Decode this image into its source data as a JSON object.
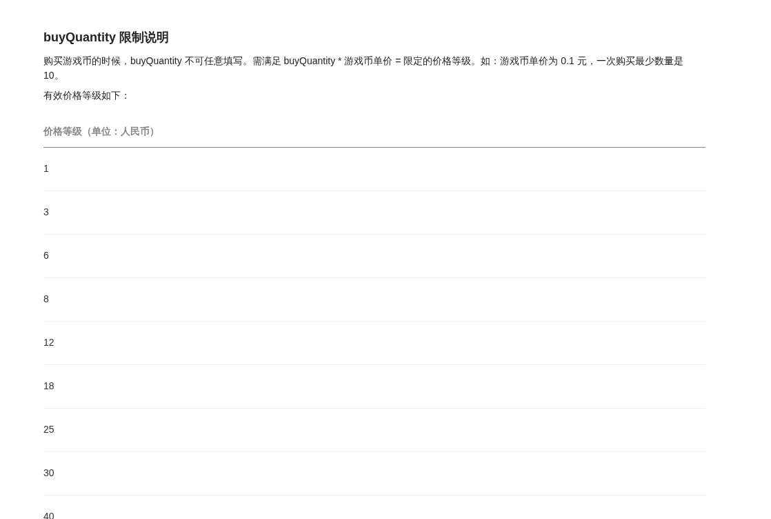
{
  "title": "buyQuantity 限制说明",
  "paragraphs": [
    "购买游戏币的时候，buyQuantity 不可任意填写。需满足 buyQuantity * 游戏币单价 = 限定的价格等级。如：游戏币单价为 0.1 元，一次购买最少数量是 10。",
    "有效价格等级如下："
  ],
  "table": {
    "columns": [
      "价格等级（单位：人民币）"
    ],
    "rows": [
      [
        "1"
      ],
      [
        "3"
      ],
      [
        "6"
      ],
      [
        "8"
      ],
      [
        "12"
      ],
      [
        "18"
      ],
      [
        "25"
      ],
      [
        "30"
      ],
      [
        "40"
      ]
    ]
  }
}
